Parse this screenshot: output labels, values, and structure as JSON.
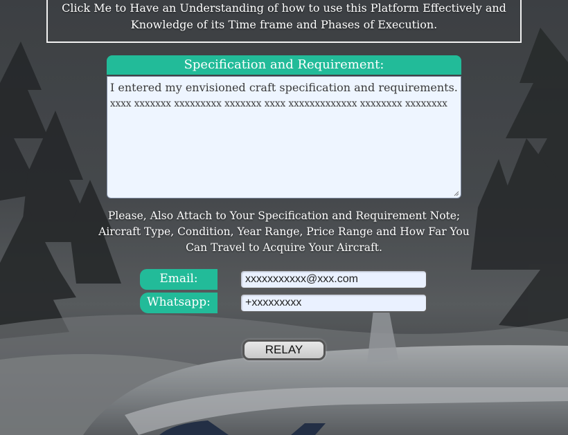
{
  "info_box": {
    "line1": "Click Me to Have an Understanding of how to use this Platform Effectively and",
    "line2": "Knowledge of its Time frame and Phases of Execution."
  },
  "spec": {
    "title": "Specification and Requirement:",
    "line1": "I entered my envisioned craft specification and requirements.",
    "line2": "xxxx xxxxxxx xxxxxxxxx xxxxxxx xxxx xxxxxxxxxxxxx xxxxxxxx xxxxxxxx"
  },
  "note": "Please, Also Attach to Your Specification and Requirement Note;  Aircraft Type, Condition, Year Range, Price Range and How Far You Can Travel to Acquire Your Aircraft.",
  "contact": {
    "email_label": "Email:",
    "email_value": "xxxxxxxxxxx@xxx.com",
    "whatsapp_label": "Whatsapp:",
    "whatsapp_value": "+xxxxxxxxx"
  },
  "relay_label": "RELAY",
  "colors": {
    "accent": "#22bb99",
    "field_bg": "#eaf1ff"
  }
}
